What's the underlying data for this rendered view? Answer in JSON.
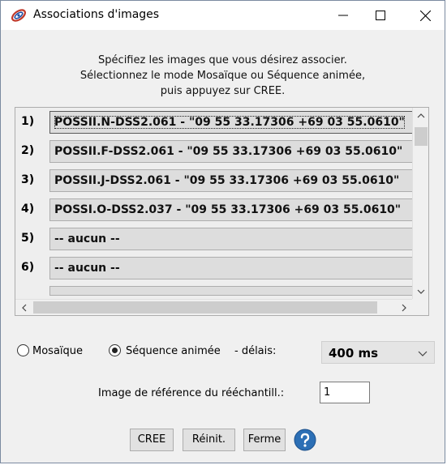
{
  "window": {
    "title": "Associations d'images"
  },
  "instructions": [
    "Spécifiez les images que vous désirez associer.",
    "Sélectionnez le mode Mosaïque ou Séquence animée,",
    "puis appuyez sur CREE."
  ],
  "images": [
    {
      "num": "1)",
      "label": "POSSII.N-DSS2.061 - \"09 55 33.17306 +69 03 55.0610\""
    },
    {
      "num": "2)",
      "label": "POSSII.F-DSS2.061 - \"09 55 33.17306 +69 03 55.0610\""
    },
    {
      "num": "3)",
      "label": "POSSII.J-DSS2.061 - \"09 55 33.17306 +69 03 55.0610\""
    },
    {
      "num": "4)",
      "label": "POSSI.O-DSS2.037 - \"09 55 33.17306 +69 03 55.0610\""
    },
    {
      "num": "5)",
      "label": "-- aucun --"
    },
    {
      "num": "6)",
      "label": "-- aucun --"
    }
  ],
  "mode": {
    "mosaic_label": "Mosaïque",
    "sequence_label": "Séquence animée",
    "selected": "sequence",
    "delay_label": "- délais:",
    "delay_value": "400 ms"
  },
  "reference": {
    "label": "Image de référence du rééchantill.:",
    "value": "1"
  },
  "buttons": {
    "create": "CREE",
    "reset": "Réinit.",
    "close": "Ferme"
  },
  "icons": {
    "app": "ring-logo-icon",
    "help": "help-icon",
    "help_color": "#2c6fb5"
  }
}
